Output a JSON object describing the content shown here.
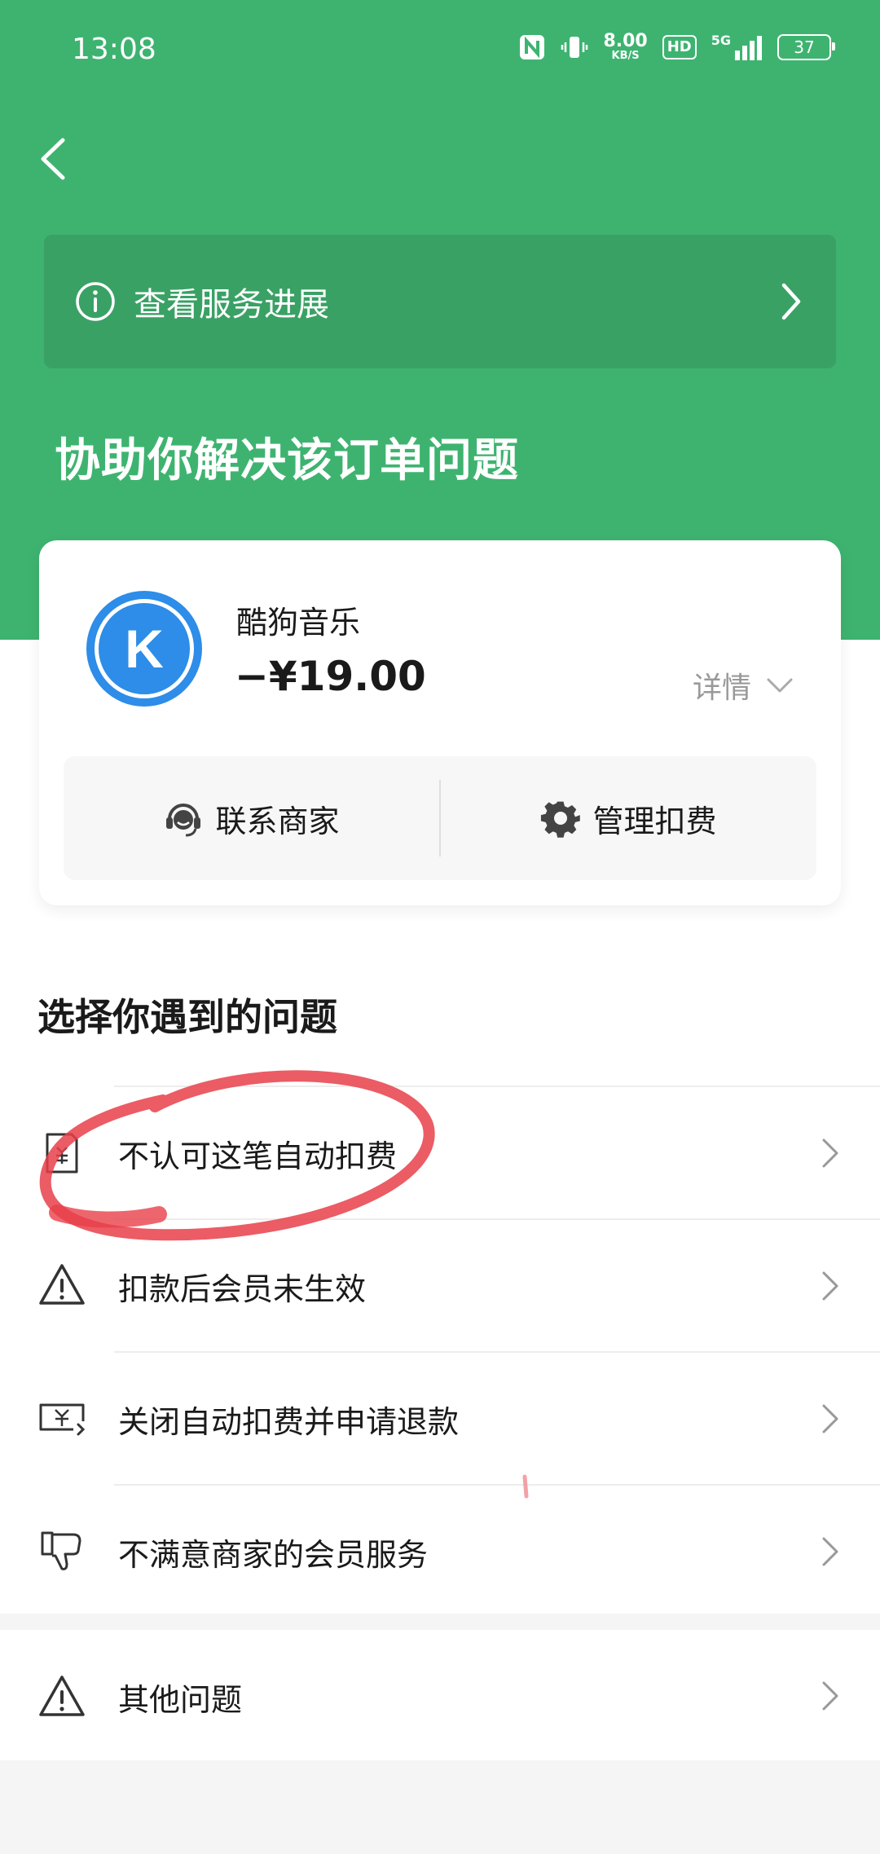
{
  "status_bar": {
    "time": "13:08",
    "net_speed": "8.00",
    "net_unit": "KB/S",
    "hd": "HD",
    "signal": "5G",
    "battery": "37"
  },
  "progress_banner": {
    "label": "查看服务进展"
  },
  "hero": {
    "title": "协助你解决该订单问题"
  },
  "order": {
    "merchant": "酷狗音乐",
    "logo_letter": "K",
    "amount": "−¥19.00",
    "details_label": "详情",
    "actions": [
      {
        "label": "联系商家",
        "icon": "headset-icon"
      },
      {
        "label": "管理扣费",
        "icon": "gear-icon"
      }
    ]
  },
  "issues": {
    "title": "选择你遇到的问题",
    "items": [
      {
        "label": "不认可这笔自动扣费",
        "icon": "receipt-icon"
      },
      {
        "label": "扣款后会员未生效",
        "icon": "warning-icon"
      },
      {
        "label": "关闭自动扣费并申请退款",
        "icon": "refund-icon"
      },
      {
        "label": "不满意商家的会员服务",
        "icon": "thumbs-down-icon"
      }
    ],
    "other": {
      "label": "其他问题",
      "icon": "warning-icon"
    }
  },
  "colors": {
    "brand_green": "#3eb370",
    "banner_green": "#3aa165",
    "annotation_red": "#e8404a",
    "logo_blue": "#2d8de8"
  }
}
